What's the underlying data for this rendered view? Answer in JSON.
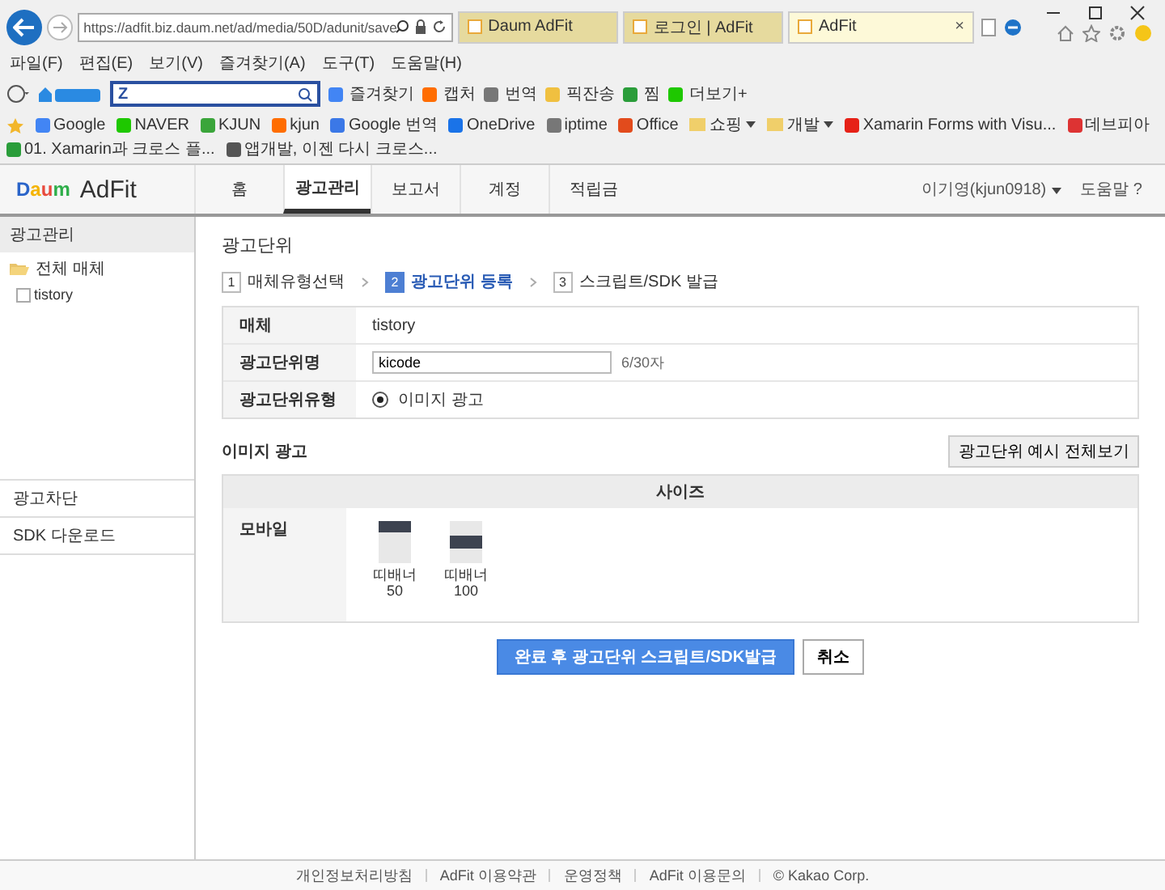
{
  "browser": {
    "url": "https://adfit.biz.daum.net/ad/media/50D/adunit/save",
    "tabs": [
      {
        "label": "Daum AdFit",
        "selected": false
      },
      {
        "label": "로그인 | AdFit",
        "selected": false
      },
      {
        "label": "AdFit",
        "selected": true,
        "close": "×"
      }
    ],
    "menu": [
      "파일(F)",
      "편집(E)",
      "보기(V)",
      "즐겨찾기(A)",
      "도구(T)",
      "도움말(H)"
    ],
    "search_value": "Z",
    "toolbar": [
      "즐겨찾기",
      "캡처",
      "번역",
      "픽잔송",
      "찜",
      "더보기+"
    ],
    "favorites": [
      {
        "label": "Google",
        "kind": "link"
      },
      {
        "label": "NAVER",
        "kind": "link"
      },
      {
        "label": "KJUN",
        "kind": "link"
      },
      {
        "label": "kjun",
        "kind": "link"
      },
      {
        "label": "Google 번역",
        "kind": "link"
      },
      {
        "label": "OneDrive",
        "kind": "link"
      },
      {
        "label": "iptime",
        "kind": "link"
      },
      {
        "label": "Office",
        "kind": "link"
      },
      {
        "label": "쇼핑",
        "kind": "folder"
      },
      {
        "label": "개발",
        "kind": "folder"
      },
      {
        "label": "Xamarin Forms with Visu...",
        "kind": "link"
      },
      {
        "label": "데브피아",
        "kind": "link"
      },
      {
        "label": "01. Xamarin과 크로스 플...",
        "kind": "link"
      },
      {
        "label": "앱개발, 이젠 다시 크로스...",
        "kind": "link"
      }
    ]
  },
  "app": {
    "logo_mark": "Daum",
    "logo_name": "AdFit",
    "nav": [
      {
        "label": "홈",
        "selected": false
      },
      {
        "label": "광고관리",
        "selected": true
      },
      {
        "label": "보고서",
        "selected": false
      },
      {
        "label": "계정",
        "selected": false
      },
      {
        "label": "적립금",
        "selected": false
      }
    ],
    "user": "이기영(kjun0918)",
    "help": "도움말 ?"
  },
  "sidebar": {
    "title": "광고관리",
    "tree": [
      {
        "label": "전체 매체",
        "expanded": true,
        "children": [
          {
            "label": "tistory"
          }
        ]
      }
    ],
    "bottom_items": [
      "광고차단",
      "SDK 다운로드"
    ]
  },
  "content": {
    "title": "광고단위",
    "steps": [
      {
        "num": "1",
        "label": "매체유형선택",
        "selected": false
      },
      {
        "num": "2",
        "label": "광고단위 등록",
        "selected": true
      },
      {
        "num": "3",
        "label": "스크립트/SDK 발급",
        "selected": false
      }
    ],
    "form": [
      {
        "label": "매체",
        "kind": "text",
        "value": "tistory"
      },
      {
        "label": "광고단위명",
        "kind": "input",
        "value": "kicode",
        "counter": "6/30자"
      },
      {
        "label": "광고단위유형",
        "kind": "radio",
        "value": "이미지 광고",
        "checked": true
      }
    ],
    "section_title": "이미지 광고",
    "preview_button": "광고단위 예시 전체보기",
    "size_header": "사이즈",
    "size_row": "모바일",
    "sizes": [
      {
        "label": "띠배너 50",
        "kind": "top"
      },
      {
        "label": "띠배너 100",
        "kind": "middle"
      }
    ],
    "submit": "완료 후 광고단위 스크립트/SDK발급",
    "cancel": "취소"
  },
  "footer": [
    "개인정보처리방침",
    "AdFit 이용약관",
    "운영정책",
    "AdFit 이용문의",
    "© Kakao Corp."
  ]
}
